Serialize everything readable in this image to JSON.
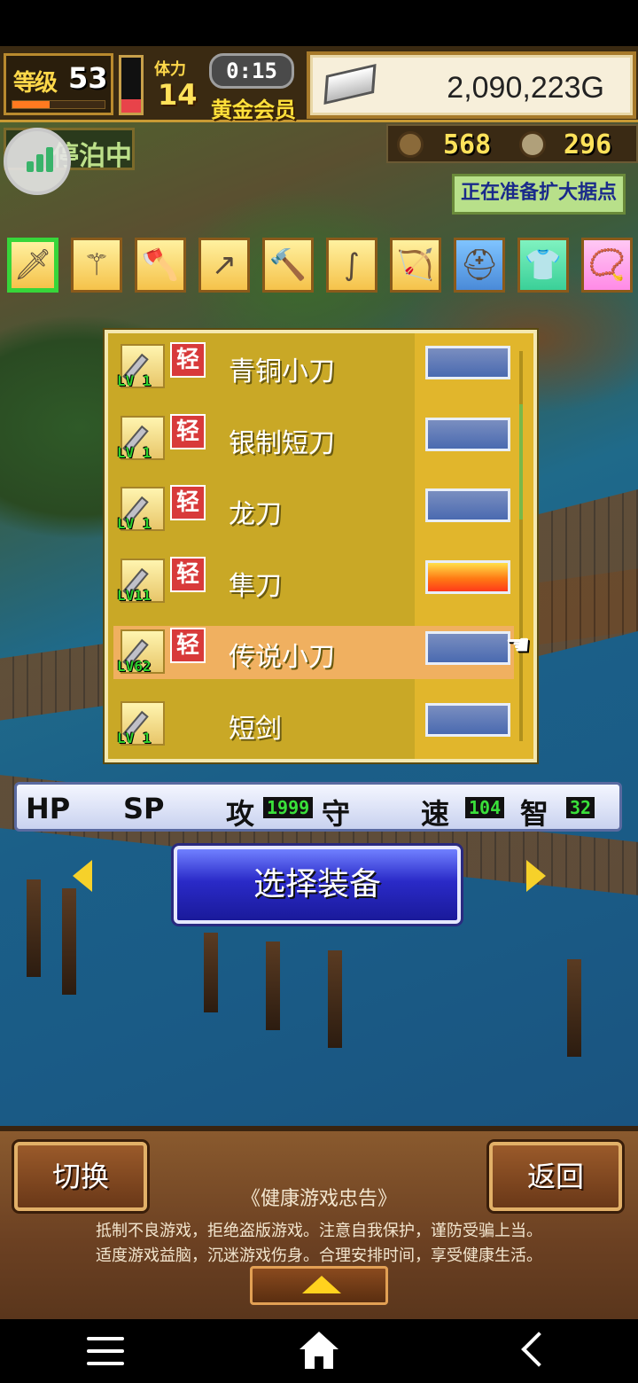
{
  "hud": {
    "level_label": "等级",
    "level": "53",
    "level_progress": 0.4,
    "hp_gauge_level": 0.25,
    "stamina_label": "体力",
    "stamina": "14",
    "timer": "0:15",
    "membership": "黄金会员",
    "gold": "2,090,223G",
    "location_status": "停泊中",
    "resource_1": "568",
    "resource_2": "296",
    "notice": "正在准备扩大据点"
  },
  "categories": [
    {
      "icon": "sword-icon",
      "glyph": "🗡",
      "selected": true
    },
    {
      "icon": "staff-icon",
      "glyph": "⚚",
      "selected": false
    },
    {
      "icon": "axe-icon",
      "glyph": "🪓",
      "selected": false
    },
    {
      "icon": "spear-icon",
      "glyph": "↗",
      "selected": false
    },
    {
      "icon": "hammer-icon",
      "glyph": "🔨",
      "selected": false
    },
    {
      "icon": "whip-icon",
      "glyph": "∫",
      "selected": false
    },
    {
      "icon": "bow-icon",
      "glyph": "🏹",
      "selected": false
    },
    {
      "icon": "helmet-icon",
      "glyph": "⛑",
      "selected": false
    },
    {
      "icon": "armor-icon",
      "glyph": "👕",
      "selected": false
    },
    {
      "icon": "necklace-icon",
      "glyph": "📿",
      "selected": false
    }
  ],
  "equipment_list": [
    {
      "name": "青铜小刀",
      "level": "LV 1",
      "tag": "轻",
      "highlight": false,
      "hot": false
    },
    {
      "name": "银制短刀",
      "level": "LV 1",
      "tag": "轻",
      "highlight": false,
      "hot": false
    },
    {
      "name": "龙刀",
      "level": "LV 1",
      "tag": "轻",
      "highlight": false,
      "hot": false
    },
    {
      "name": "隼刀",
      "level": "LV11",
      "tag": "轻",
      "highlight": false,
      "hot": true
    },
    {
      "name": "传说小刀",
      "level": "LV62",
      "tag": "轻",
      "highlight": true,
      "hot": false
    },
    {
      "name": "短剑",
      "level": "LV 1",
      "tag": "",
      "highlight": false,
      "hot": false
    }
  ],
  "stats": {
    "hp_label": "HP",
    "sp_label": "SP",
    "atk_label": "攻",
    "atk_value": "1999",
    "def_label": "守",
    "spd_label": "速",
    "spd_value": "104",
    "int_label": "智",
    "int_value": "32"
  },
  "select_button": "选择装备",
  "switch_button": "切换",
  "back_button": "返回",
  "health_notice": {
    "title": "《健康游戏忠告》",
    "line1": "抵制不良游戏，拒绝盗版游戏。注意自我保护，谨防受骗上当。",
    "line2": "适度游戏益脑，沉迷游戏伤身。合理安排时间，享受健康生活。"
  },
  "colors": {
    "panel_gold": "#c9a826",
    "select_blue": "#2a2ac8",
    "highlight_row": "#f0b060",
    "gauge_hot": "#ff7a14"
  }
}
